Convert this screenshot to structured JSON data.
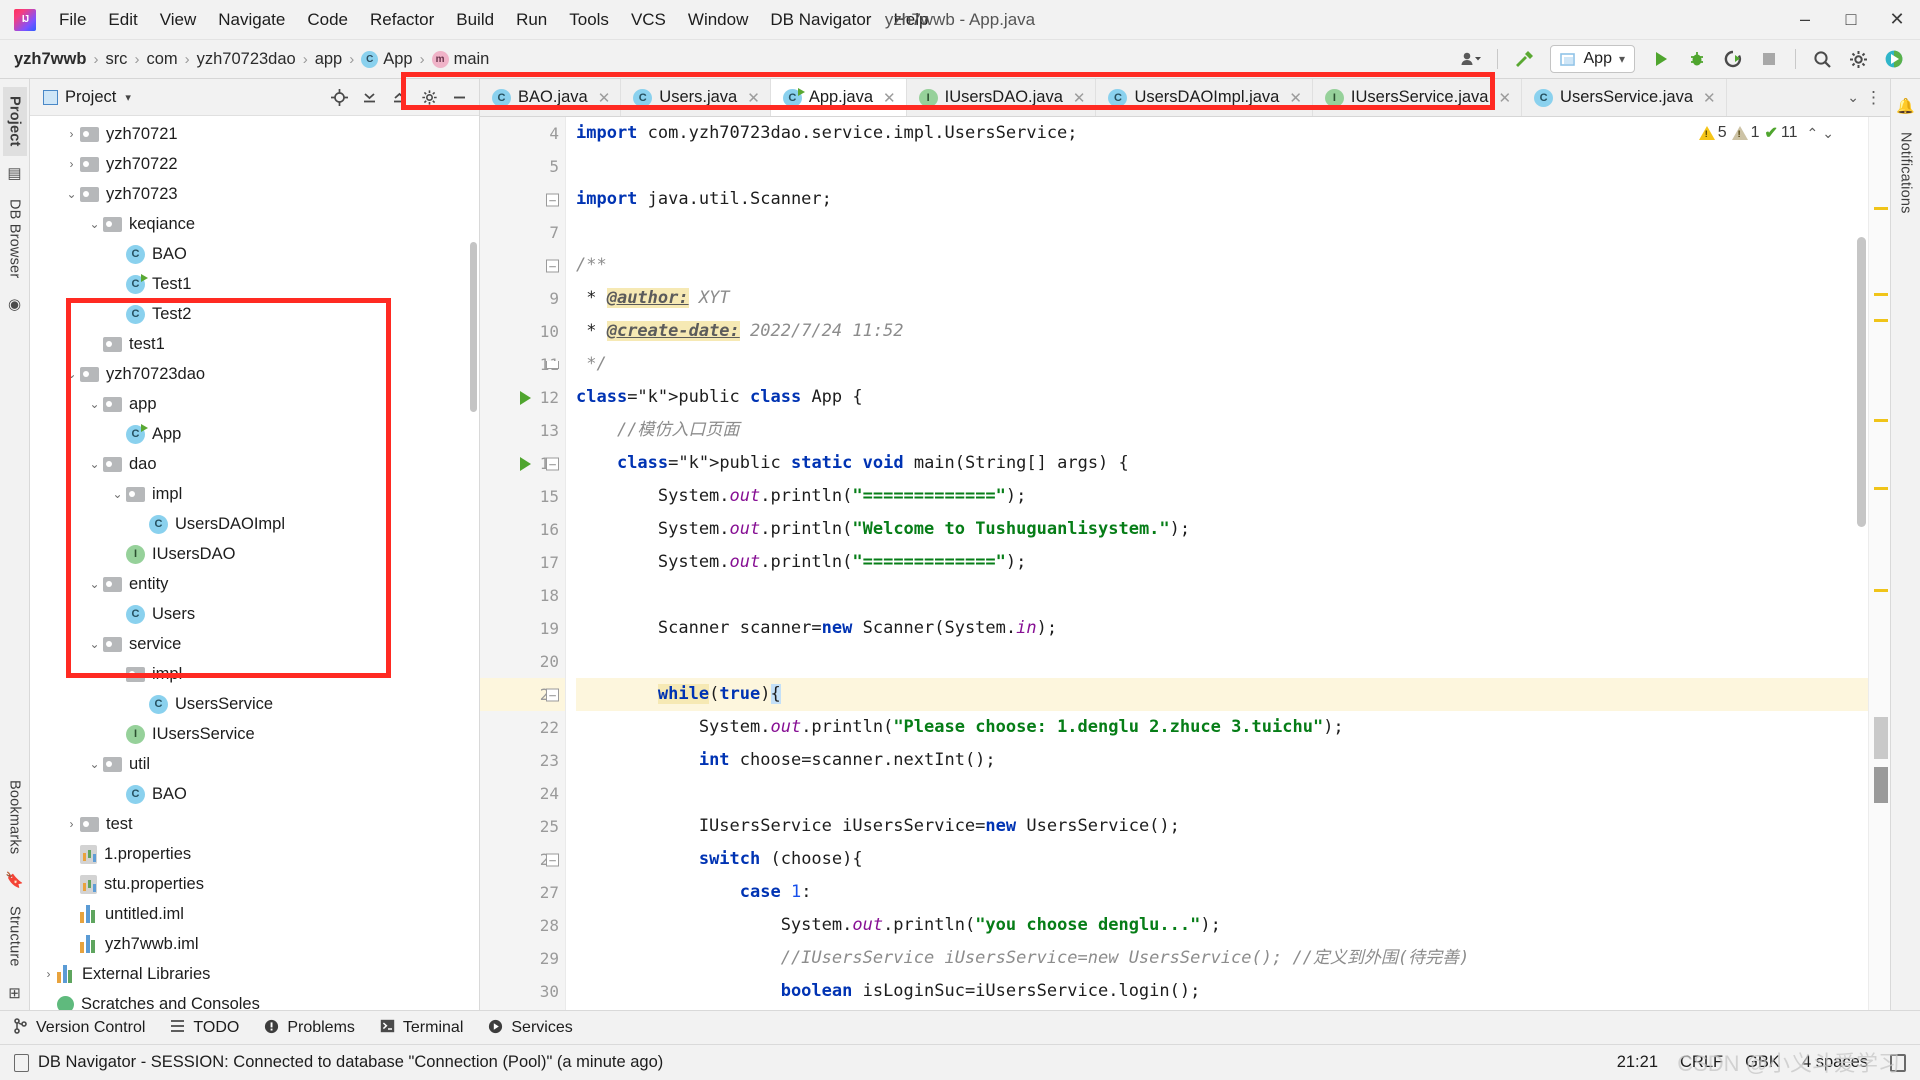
{
  "window": {
    "title": "yzh7wwb - App.java",
    "minimize": "–",
    "maximize": "□",
    "close": "✕"
  },
  "menubar": {
    "items": [
      "File",
      "Edit",
      "View",
      "Navigate",
      "Code",
      "Refactor",
      "Build",
      "Run",
      "Tools",
      "VCS",
      "Window",
      "DB Navigator",
      "Help"
    ]
  },
  "breadcrumb": {
    "items": [
      {
        "label": "yzh7wwb",
        "icon": "",
        "bold": true
      },
      {
        "label": "src",
        "icon": ""
      },
      {
        "label": "com",
        "icon": ""
      },
      {
        "label": "yzh70723dao",
        "icon": ""
      },
      {
        "label": "app",
        "icon": ""
      },
      {
        "label": "App",
        "icon": "class-icon"
      },
      {
        "label": "main",
        "icon": "method-icon"
      }
    ],
    "separator": "›"
  },
  "toolbar": {
    "user_icon": "user-icon",
    "build_icon": "hammer-icon",
    "run_config": "App",
    "run_icon": "run-icon",
    "debug_icon": "debug-icon",
    "coverage_icon": "run-with-coverage-icon",
    "stop_icon": "stop-icon",
    "search_icon": "search-icon",
    "settings_icon": "gear-icon",
    "updates_icon": "ide-updates-icon",
    "caret": "▾"
  },
  "left_strip": {
    "project_tab": "Project",
    "db_browser_tab": "DB Browser",
    "bookmarks_tab": "Bookmarks",
    "structure_tab": "Structure"
  },
  "right_strip": {
    "notifications_tab": "Notifications"
  },
  "project_panel": {
    "title": "Project",
    "caret": "▾",
    "actions": [
      "locate-icon",
      "expand-all-icon",
      "collapse-all-icon",
      "settings-icon",
      "hide-icon"
    ],
    "tree": [
      {
        "label": "yzh70721",
        "indent": 1,
        "arrow": "›",
        "icon": "folder"
      },
      {
        "label": "yzh70722",
        "indent": 1,
        "arrow": "›",
        "icon": "folder"
      },
      {
        "label": "yzh70723",
        "indent": 1,
        "arrow": "⌄",
        "icon": "folder"
      },
      {
        "label": "keqiance",
        "indent": 2,
        "arrow": "⌄",
        "icon": "folder"
      },
      {
        "label": "BAO",
        "indent": 3,
        "arrow": "",
        "icon": "class"
      },
      {
        "label": "Test1",
        "indent": 3,
        "arrow": "",
        "icon": "class-runnable"
      },
      {
        "label": "Test2",
        "indent": 3,
        "arrow": "",
        "icon": "class"
      },
      {
        "label": "test1",
        "indent": 2,
        "arrow": "",
        "icon": "folder"
      },
      {
        "label": "yzh70723dao",
        "indent": 1,
        "arrow": "⌄",
        "icon": "folder"
      },
      {
        "label": "app",
        "indent": 2,
        "arrow": "⌄",
        "icon": "folder"
      },
      {
        "label": "App",
        "indent": 3,
        "arrow": "",
        "icon": "class-runnable"
      },
      {
        "label": "dao",
        "indent": 2,
        "arrow": "⌄",
        "icon": "folder"
      },
      {
        "label": "impl",
        "indent": 3,
        "arrow": "⌄",
        "icon": "folder"
      },
      {
        "label": "UsersDAOImpl",
        "indent": 4,
        "arrow": "",
        "icon": "class"
      },
      {
        "label": "IUsersDAO",
        "indent": 3,
        "arrow": "",
        "icon": "interface"
      },
      {
        "label": "entity",
        "indent": 2,
        "arrow": "⌄",
        "icon": "folder"
      },
      {
        "label": "Users",
        "indent": 3,
        "arrow": "",
        "icon": "class"
      },
      {
        "label": "service",
        "indent": 2,
        "arrow": "⌄",
        "icon": "folder"
      },
      {
        "label": "impl",
        "indent": 3,
        "arrow": "⌄",
        "icon": "folder"
      },
      {
        "label": "UsersService",
        "indent": 4,
        "arrow": "",
        "icon": "class"
      },
      {
        "label": "IUsersService",
        "indent": 3,
        "arrow": "",
        "icon": "interface"
      },
      {
        "label": "util",
        "indent": 2,
        "arrow": "⌄",
        "icon": "folder"
      },
      {
        "label": "BAO",
        "indent": 3,
        "arrow": "",
        "icon": "class"
      },
      {
        "label": "test",
        "indent": 1,
        "arrow": "›",
        "icon": "folder"
      },
      {
        "label": "1.properties",
        "indent": 1,
        "arrow": "",
        "icon": "properties"
      },
      {
        "label": "stu.properties",
        "indent": 1,
        "arrow": "",
        "icon": "properties"
      },
      {
        "label": "untitled.iml",
        "indent": 1,
        "arrow": "",
        "icon": "module"
      },
      {
        "label": "yzh7wwb.iml",
        "indent": 1,
        "arrow": "",
        "icon": "module"
      },
      {
        "label": "External Libraries",
        "indent": 0,
        "arrow": "›",
        "icon": "library"
      },
      {
        "label": "Scratches and Consoles",
        "indent": 0,
        "arrow": "",
        "icon": "scratch"
      }
    ]
  },
  "editor_tabs": [
    {
      "label": "BAO.java",
      "icon": "class",
      "active": false,
      "close": "✕"
    },
    {
      "label": "Users.java",
      "icon": "class",
      "active": false,
      "close": "✕"
    },
    {
      "label": "App.java",
      "icon": "class-runnable",
      "active": true,
      "close": "✕"
    },
    {
      "label": "IUsersDAO.java",
      "icon": "interface",
      "active": false,
      "close": "✕"
    },
    {
      "label": "UsersDAOImpl.java",
      "icon": "class",
      "active": false,
      "close": "✕"
    },
    {
      "label": "IUsersService.java",
      "icon": "interface",
      "active": false,
      "close": "✕"
    },
    {
      "label": "UsersService.java",
      "icon": "class",
      "active": false,
      "close": "✕"
    }
  ],
  "tabbar_actions": {
    "chevron": "⌄",
    "kebab": "⋮"
  },
  "inspection": {
    "warnings_count": "5",
    "weak_warnings_count": "1",
    "checks_count": "11",
    "up": "⌃",
    "down": "⌄"
  },
  "code": {
    "first_line_number": 4,
    "lines": [
      {
        "n": 4,
        "run": false,
        "fold": "",
        "text": "import com.yzh70723dao.service.impl.UsersService;"
      },
      {
        "n": 5,
        "run": false,
        "fold": "",
        "text": ""
      },
      {
        "n": 6,
        "run": false,
        "fold": "minus",
        "text": "import java.util.Scanner;"
      },
      {
        "n": 7,
        "run": false,
        "fold": "",
        "text": ""
      },
      {
        "n": 8,
        "run": false,
        "fold": "minus",
        "text": "/**"
      },
      {
        "n": 9,
        "run": false,
        "fold": "",
        "text": " * @author: XYT"
      },
      {
        "n": 10,
        "run": false,
        "fold": "",
        "text": " * @create-date: 2022/7/24 11:52"
      },
      {
        "n": 11,
        "run": false,
        "fold": "end",
        "text": " */"
      },
      {
        "n": 12,
        "run": true,
        "fold": "",
        "text": "public class App {"
      },
      {
        "n": 13,
        "run": false,
        "fold": "",
        "text": "    //模仿入口页面"
      },
      {
        "n": 14,
        "run": true,
        "fold": "minus",
        "text": "    public static void main(String[] args) {"
      },
      {
        "n": 15,
        "run": false,
        "fold": "",
        "text": "        System.out.println(\"=============\");"
      },
      {
        "n": 16,
        "run": false,
        "fold": "",
        "text": "        System.out.println(\"Welcome to Tushuguanlisystem.\");"
      },
      {
        "n": 17,
        "run": false,
        "fold": "",
        "text": "        System.out.println(\"=============\");"
      },
      {
        "n": 18,
        "run": false,
        "fold": "",
        "text": ""
      },
      {
        "n": 19,
        "run": false,
        "fold": "",
        "text": "        Scanner scanner=new Scanner(System.in);"
      },
      {
        "n": 20,
        "run": false,
        "fold": "",
        "text": ""
      },
      {
        "n": 21,
        "run": false,
        "fold": "minus",
        "text": "        while(true){",
        "highlight": true
      },
      {
        "n": 22,
        "run": false,
        "fold": "",
        "text": "            System.out.println(\"Please choose: 1.denglu 2.zhuce 3.tuichu\");"
      },
      {
        "n": 23,
        "run": false,
        "fold": "",
        "text": "            int choose=scanner.nextInt();"
      },
      {
        "n": 24,
        "run": false,
        "fold": "",
        "text": ""
      },
      {
        "n": 25,
        "run": false,
        "fold": "",
        "text": "            IUsersService iUsersService=new UsersService();"
      },
      {
        "n": 26,
        "run": false,
        "fold": "minus",
        "text": "            switch (choose){"
      },
      {
        "n": 27,
        "run": false,
        "fold": "",
        "text": "                case 1:"
      },
      {
        "n": 28,
        "run": false,
        "fold": "",
        "text": "                    System.out.println(\"you choose denglu...\");"
      },
      {
        "n": 29,
        "run": false,
        "fold": "",
        "text": "                    //IUsersService iUsersService=new UsersService(); //定义到外围(待完善)"
      },
      {
        "n": 30,
        "run": false,
        "fold": "",
        "text": "                    boolean isLoginSuc=iUsersService.login();"
      }
    ]
  },
  "tool_windows": [
    {
      "label": "Version Control",
      "icon": "branch-icon"
    },
    {
      "label": "TODO",
      "icon": "list-icon"
    },
    {
      "label": "Problems",
      "icon": "error-icon"
    },
    {
      "label": "Terminal",
      "icon": "terminal-icon"
    },
    {
      "label": "Services",
      "icon": "services-icon"
    }
  ],
  "statusbar": {
    "icon": "db-navigator-icon",
    "message": "DB Navigator  - SESSION: Connected to database \"Connection (Pool)\" (a minute ago)",
    "caret_position": "21:21",
    "line_separator": "CRLF",
    "encoding": "GBK",
    "indent": "4 spaces",
    "lock_icon": "lock-icon",
    "watermark": "CSDN @小义斗爱学习"
  },
  "colors": {
    "highlight_box": "#ff2a22",
    "keyword": "#0033b3",
    "string": "#067d17",
    "comment": "#8c8c8c",
    "static_field": "#871094",
    "number": "#1750eb",
    "javadoc_tag_bg": "#f6e9b4",
    "current_line_bg": "#fdf6dd"
  }
}
